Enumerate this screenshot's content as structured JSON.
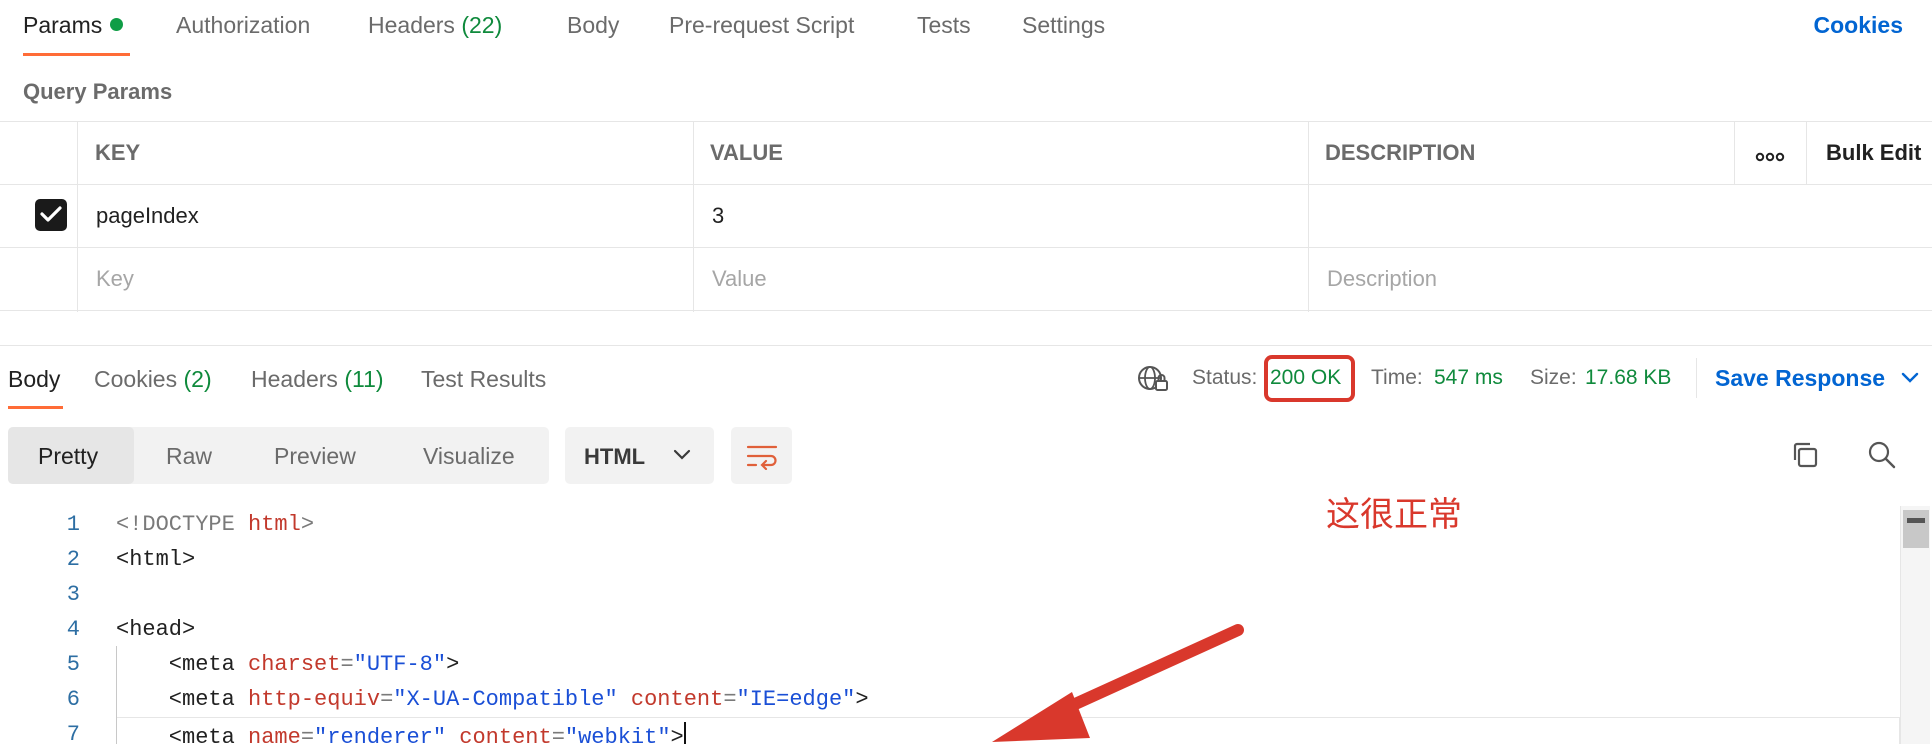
{
  "request_tabs": [
    {
      "label": "Params",
      "count": "",
      "active": true
    },
    {
      "label": "Authorization",
      "count": ""
    },
    {
      "label": "Headers",
      "count": "(22)"
    },
    {
      "label": "Body",
      "count": ""
    },
    {
      "label": "Pre-request Script",
      "count": ""
    },
    {
      "label": "Tests",
      "count": ""
    },
    {
      "label": "Settings",
      "count": ""
    }
  ],
  "cookies_link": "Cookies",
  "query_params": {
    "title": "Query Params",
    "headers": {
      "key": "KEY",
      "value": "VALUE",
      "description": "DESCRIPTION",
      "bulk_edit": "Bulk Edit"
    },
    "rows": [
      {
        "checked": true,
        "key": "pageIndex",
        "value": "3",
        "description": ""
      }
    ],
    "placeholder": {
      "key": "Key",
      "value": "Value",
      "description": "Description"
    }
  },
  "response_tabs": [
    {
      "label": "Body",
      "count": "",
      "active": true
    },
    {
      "label": "Cookies",
      "count": "(2)"
    },
    {
      "label": "Headers",
      "count": "(11)"
    },
    {
      "label": "Test Results",
      "count": ""
    }
  ],
  "status": {
    "status_label": "Status:",
    "status_value": "200 OK",
    "time_label": "Time:",
    "time_value": "547 ms",
    "size_label": "Size:",
    "size_value": "17.68 KB"
  },
  "save_response": "Save Response",
  "view_modes": [
    "Pretty",
    "Raw",
    "Preview",
    "Visualize"
  ],
  "language": "HTML",
  "code_lines": [
    {
      "n": "1",
      "tokens": [
        [
          "g",
          "<!DOCTYPE "
        ],
        [
          "r",
          "html"
        ],
        [
          "g",
          ">"
        ]
      ]
    },
    {
      "n": "2",
      "tokens": [
        [
          "d",
          "<html>"
        ]
      ]
    },
    {
      "n": "3",
      "tokens": []
    },
    {
      "n": "4",
      "tokens": [
        [
          "d",
          "<head>"
        ]
      ]
    },
    {
      "n": "5",
      "tokens": [
        [
          "d",
          "    <meta "
        ],
        [
          "r",
          "charset"
        ],
        [
          "g",
          "="
        ],
        [
          "b",
          "\"UTF-8\""
        ],
        [
          "d",
          ">"
        ]
      ]
    },
    {
      "n": "6",
      "tokens": [
        [
          "d",
          "    <meta "
        ],
        [
          "r",
          "http-equiv"
        ],
        [
          "g",
          "="
        ],
        [
          "b",
          "\"X-UA-Compatible\""
        ],
        [
          "d",
          " "
        ],
        [
          "r",
          "content"
        ],
        [
          "g",
          "="
        ],
        [
          "b",
          "\"IE=edge\""
        ],
        [
          "d",
          ">"
        ]
      ]
    },
    {
      "n": "7",
      "tokens": [
        [
          "d",
          "    <meta "
        ],
        [
          "r",
          "name"
        ],
        [
          "g",
          "="
        ],
        [
          "b",
          "\"renderer\""
        ],
        [
          "d",
          " "
        ],
        [
          "r",
          "content"
        ],
        [
          "g",
          "="
        ],
        [
          "b",
          "\"webkit\""
        ],
        [
          "d",
          ">"
        ]
      ]
    }
  ],
  "annotation": "这很正常",
  "colors": {
    "accent": "#ff6c37",
    "link": "#0265d2",
    "success": "#0f8a3c",
    "annotation": "#d9382c"
  }
}
